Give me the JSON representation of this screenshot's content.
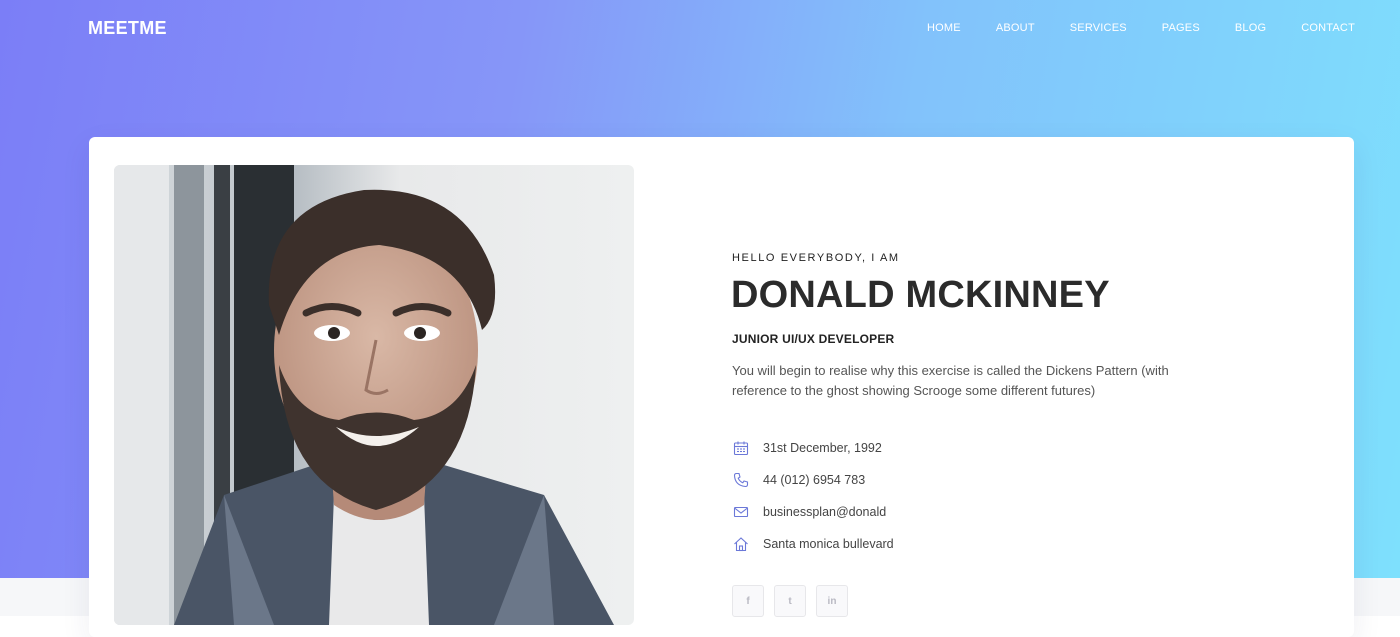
{
  "brand": {
    "logo_text": "MEETME"
  },
  "nav": {
    "items": [
      {
        "label": "HOME"
      },
      {
        "label": "ABOUT"
      },
      {
        "label": "SERVICES"
      },
      {
        "label": "PAGES"
      },
      {
        "label": "BLOG"
      },
      {
        "label": "CONTACT"
      }
    ]
  },
  "profile": {
    "greeting": "HELLO EVERYBODY, I AM",
    "name": "DONALD MCKINNEY",
    "role": "JUNIOR UI/UX DEVELOPER",
    "description": "You will begin to realise why this exercise is called the Dickens Pattern (with reference to the ghost showing Scrooge some different futures)",
    "photo_icon": "profile-photo"
  },
  "info": {
    "birthday": {
      "icon": "calendar-icon",
      "text": "31st December, 1992"
    },
    "phone": {
      "icon": "phone-icon",
      "text": "44 (012) 6954 783"
    },
    "email": {
      "icon": "mail-icon",
      "text": "businessplan@donald"
    },
    "address": {
      "icon": "home-icon",
      "text": "Santa monica bullevard"
    }
  },
  "social": [
    {
      "icon": "facebook-icon",
      "glyph": "f"
    },
    {
      "icon": "twitter-icon",
      "glyph": "t"
    },
    {
      "icon": "linkedin-icon",
      "glyph": "in"
    }
  ],
  "colors": {
    "gradient_start": "#7b7ef7",
    "gradient_end": "#7ee0fd",
    "icon_accent": "#6b78d8",
    "text_dark": "#2b2b2b"
  }
}
